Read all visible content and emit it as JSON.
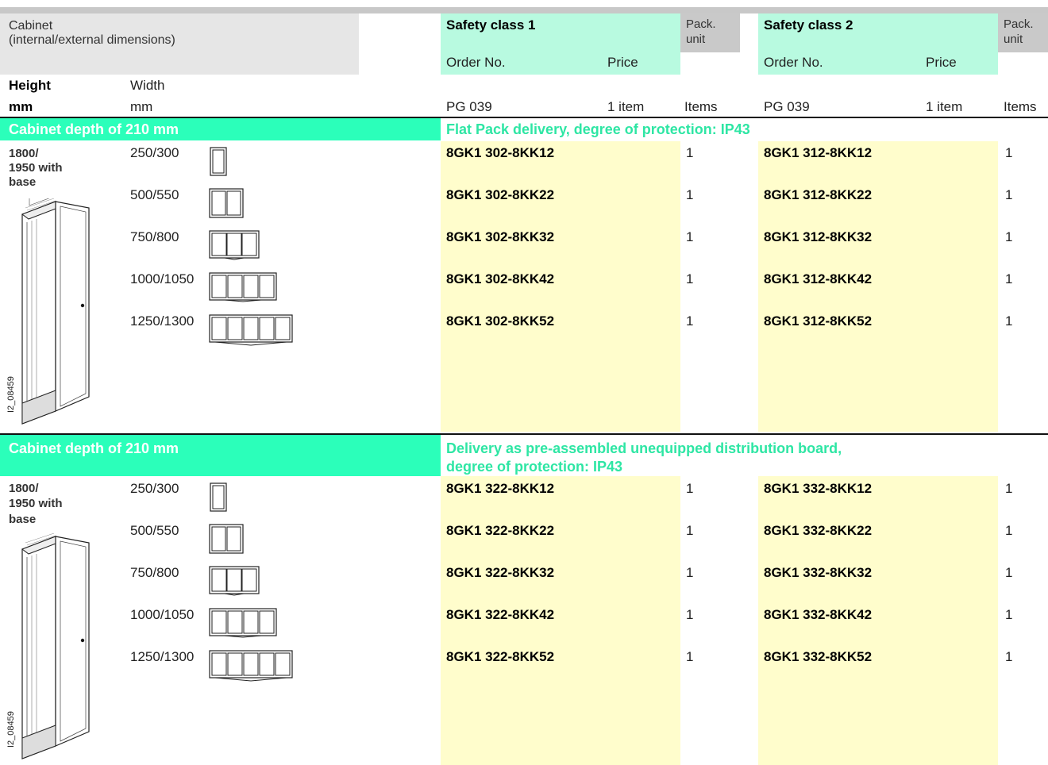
{
  "header": {
    "cabinet_label": "Cabinet",
    "cabinet_sub": "(internal/external dimensions)",
    "height_label": "Height",
    "height_unit": "mm",
    "width_label": "Width",
    "width_unit": "mm",
    "sc1_title": "Safety class 1",
    "sc2_title": "Safety class 2",
    "order_no": "Order No.",
    "price": "Price",
    "pack_unit_line1": "Pack.",
    "pack_unit_line2": "unit",
    "pg": "PG 039",
    "one_item": "1 item",
    "items": "Items"
  },
  "colors": {
    "header_gray": "#e6e6e6",
    "pack_gray": "#c9c9c9",
    "top_bar": "#c8c8c8",
    "mint": "#b8fae0",
    "band_green": "#2bffba",
    "title_green": "#2ee6a4",
    "pale_yellow": "#fffdcc"
  },
  "sections": [
    {
      "band_title": "Cabinet depth of 210 mm",
      "delivery_line1": "Flat Pack delivery, degree of protection: IP43",
      "delivery_line2": "",
      "height_l1": "1800/",
      "height_l2": "1950 with",
      "height_l3": "base",
      "drawing_code": "I2_08459",
      "rows": [
        {
          "width": "250/300",
          "sc1": "8GK1 302-8KK12",
          "pack1": "1",
          "sc2": "8GK1 312-8KK12",
          "pack2": "1"
        },
        {
          "width": "500/550",
          "sc1": "8GK1 302-8KK22",
          "pack1": "1",
          "sc2": "8GK1 312-8KK22",
          "pack2": "1"
        },
        {
          "width": "750/800",
          "sc1": "8GK1 302-8KK32",
          "pack1": "1",
          "sc2": "8GK1 312-8KK32",
          "pack2": "1"
        },
        {
          "width": "1000/1050",
          "sc1": "8GK1 302-8KK42",
          "pack1": "1",
          "sc2": "8GK1 312-8KK42",
          "pack2": "1"
        },
        {
          "width": "1250/1300",
          "sc1": "8GK1 302-8KK52",
          "pack1": "1",
          "sc2": "8GK1 312-8KK52",
          "pack2": "1"
        }
      ]
    },
    {
      "band_title": "Cabinet depth of 210 mm",
      "delivery_line1": "Delivery as pre-assembled unequipped distribution board,",
      "delivery_line2": "degree of protection: IP43",
      "height_l1": "1800/",
      "height_l2": "1950 with",
      "height_l3": "base",
      "drawing_code": "I2_08459",
      "rows": [
        {
          "width": "250/300",
          "sc1": "8GK1 322-8KK12",
          "pack1": "1",
          "sc2": "8GK1 332-8KK12",
          "pack2": "1"
        },
        {
          "width": "500/550",
          "sc1": "8GK1 322-8KK22",
          "pack1": "1",
          "sc2": "8GK1 332-8KK22",
          "pack2": "1"
        },
        {
          "width": "750/800",
          "sc1": "8GK1 322-8KK32",
          "pack1": "1",
          "sc2": "8GK1 332-8KK32",
          "pack2": "1"
        },
        {
          "width": "1000/1050",
          "sc1": "8GK1 322-8KK42",
          "pack1": "1",
          "sc2": "8GK1 332-8KK42",
          "pack2": "1"
        },
        {
          "width": "1250/1300",
          "sc1": "8GK1 322-8KK52",
          "pack1": "1",
          "sc2": "8GK1 332-8KK52",
          "pack2": "1"
        }
      ]
    }
  ]
}
